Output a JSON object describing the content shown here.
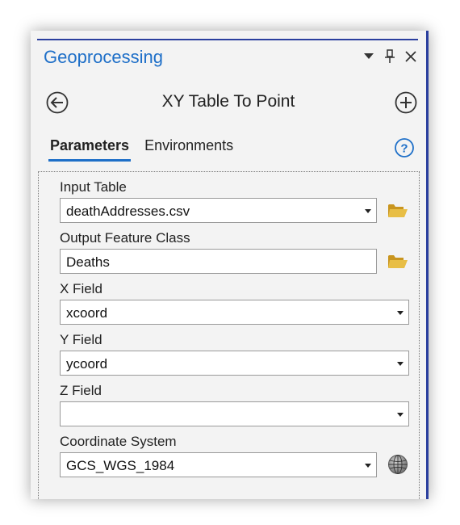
{
  "pane": {
    "title": "Geoprocessing",
    "icons": [
      "menu-caret-icon",
      "pin-icon",
      "close-icon"
    ]
  },
  "toolbar": {
    "tool_title": "XY Table To Point",
    "back_icon": "back-arrow-icon",
    "add_icon": "add-plus-icon"
  },
  "tabs": [
    {
      "label": "Parameters",
      "active": true
    },
    {
      "label": "Environments",
      "active": false
    }
  ],
  "help_icon": "help-question-icon",
  "fields": {
    "input_table": {
      "label": "Input Table",
      "value": "deathAddresses.csv"
    },
    "output_feature_class": {
      "label": "Output Feature Class",
      "value": "Deaths"
    },
    "x_field": {
      "label": "X Field",
      "value": "xcoord"
    },
    "y_field": {
      "label": "Y Field",
      "value": "ycoord"
    },
    "z_field": {
      "label": "Z Field",
      "value": ""
    },
    "coordinate_system": {
      "label": "Coordinate System",
      "value": "GCS_WGS_1984"
    }
  },
  "colors": {
    "accent": "#1e6fc8",
    "pane_border": "#2b3f9e",
    "folder": "#e0b43a"
  }
}
